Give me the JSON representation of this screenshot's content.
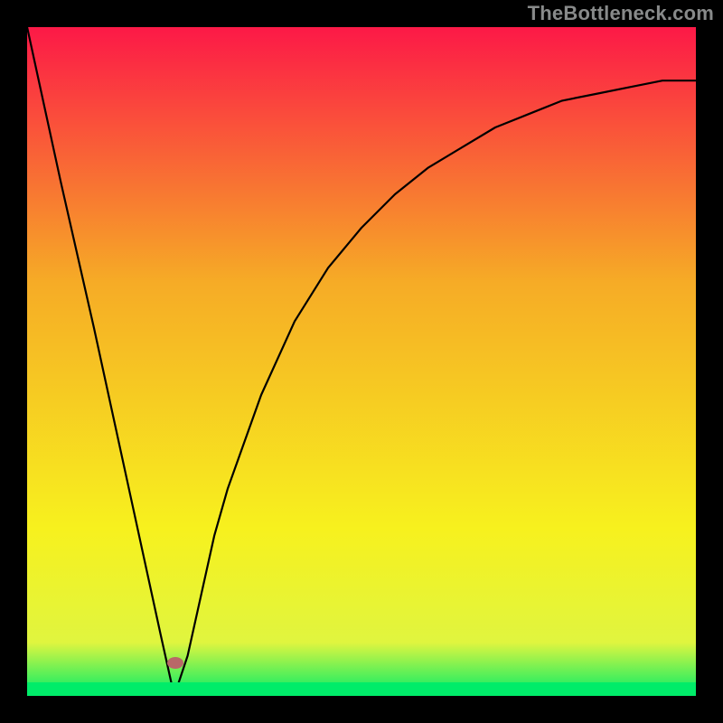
{
  "attribution": "TheBottleneck.com",
  "colors": {
    "frame_bg": "#000000",
    "gradient_top": "#fc1947",
    "gradient_mid": "#f6ab26",
    "gradient_low": "#f7f11e",
    "gradient_bottom": "#00ec69",
    "curve": "#000000",
    "bottom_band": "#00ec69",
    "marker": "#b96868"
  },
  "chart_data": {
    "type": "line",
    "title": "",
    "xlabel": "",
    "ylabel": "",
    "xlim": [
      0,
      100
    ],
    "ylim": [
      0,
      100
    ],
    "grid": false,
    "legend": false,
    "series": [
      {
        "name": "curve",
        "x": [
          0,
          5,
          10,
          15,
          20,
          22,
          24,
          26,
          28,
          30,
          35,
          40,
          45,
          50,
          55,
          60,
          65,
          70,
          75,
          80,
          85,
          90,
          95,
          100
        ],
        "y": [
          100,
          77,
          55,
          32,
          9,
          0,
          6,
          15,
          24,
          31,
          45,
          56,
          64,
          70,
          75,
          79,
          82,
          85,
          87,
          89,
          90,
          91,
          92,
          92
        ]
      }
    ],
    "annotations": {
      "marker": {
        "x": 22,
        "y": 0,
        "shape": "ellipse",
        "color_key": "marker"
      },
      "bottom_band": {
        "height_pct": 2
      }
    }
  },
  "marker_style": "left:185px; top:727px; background:#b96868;"
}
